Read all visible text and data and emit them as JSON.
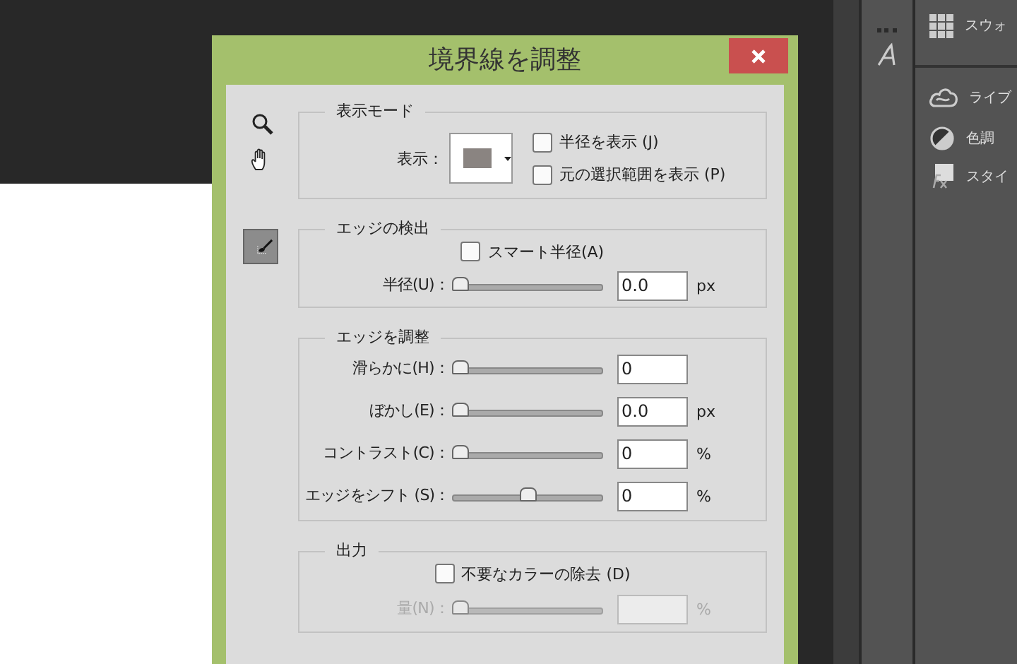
{
  "window": {
    "title": "境界線を調整"
  },
  "view_mode": {
    "legend": "表示モード",
    "display_label": "表示：",
    "checkboxes": [
      {
        "label": "半径を表示 (J)",
        "checked": false
      },
      {
        "label": "元の選択範囲を表示 (P)",
        "checked": false
      }
    ]
  },
  "edge_detection": {
    "legend": "エッジの検出",
    "smart_radius": {
      "label": "スマート半径(A)",
      "checked": false
    },
    "radius": {
      "label": "半径(U)：",
      "level": 0,
      "value": "0.0",
      "unit": "px"
    }
  },
  "adjust_edge": {
    "legend": "エッジを調整",
    "sliders": [
      {
        "label": "滑らかに(H)：",
        "level": 0,
        "value": "0"
      },
      {
        "label": "ぼかし(E)：",
        "level": 0,
        "value": "0.0",
        "unit": "px"
      },
      {
        "label": "コントラスト(C)：",
        "level": 0,
        "value": "0",
        "unit": "%"
      },
      {
        "label": "エッジをシフト (S)：",
        "level": 0.5,
        "value": "0",
        "unit": "%"
      }
    ]
  },
  "output": {
    "legend": "出力",
    "decontaminate": {
      "label": "不要なカラーの除去 (D)",
      "checked": false
    },
    "amount": {
      "label": "量(N)：",
      "level": 0,
      "unit": "%",
      "disabled": true
    }
  },
  "side_panel": {
    "items": [
      {
        "kind": "swatches",
        "label": "スウォ"
      },
      {
        "kind": "libraries",
        "label": "ライブ"
      },
      {
        "kind": "adjustments",
        "label": "色調"
      },
      {
        "kind": "styles",
        "label": "スタイ"
      }
    ]
  }
}
